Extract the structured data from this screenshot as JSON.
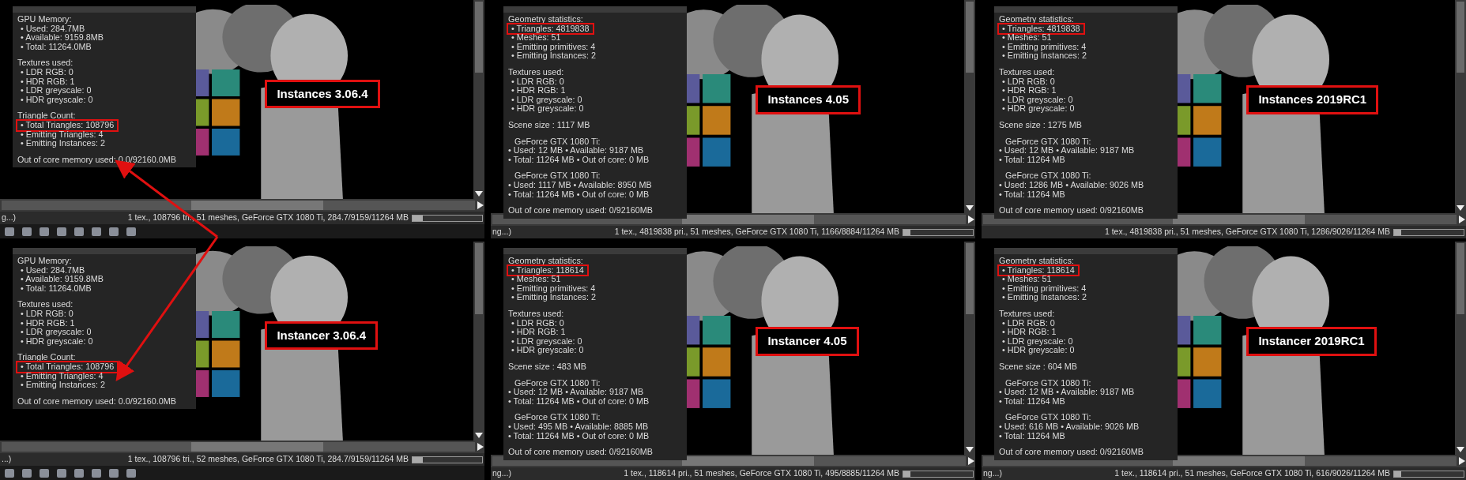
{
  "panels": [
    {
      "label": "Instances 3.06.4",
      "toolbar": true,
      "status_left": "g...)",
      "status": "1 tex., 108796 tri., 51 meshes, GeForce GTX 1080 Ti, 284.7/9159/11264 MB",
      "level": 0.15,
      "sections": [
        [
          {
            "kind": "heading",
            "text": "GPU Memory:",
            "highlighted": false
          },
          {
            "kind": "item",
            "text": "• Used: 284.7MB",
            "highlighted": false
          },
          {
            "kind": "item",
            "text": "• Available: 9159.8MB",
            "highlighted": false
          },
          {
            "kind": "item",
            "text": "• Total: 11264.0MB",
            "highlighted": false
          }
        ],
        [
          {
            "kind": "heading",
            "text": "Textures used:",
            "highlighted": false
          },
          {
            "kind": "item",
            "text": "• LDR RGB: 0",
            "highlighted": false
          },
          {
            "kind": "item",
            "text": "• HDR RGB: 1",
            "highlighted": false
          },
          {
            "kind": "item",
            "text": "• LDR greyscale: 0",
            "highlighted": false
          },
          {
            "kind": "item",
            "text": "• HDR greyscale: 0",
            "highlighted": false
          }
        ],
        [
          {
            "kind": "heading",
            "text": "Triangle Count:",
            "highlighted": false
          },
          {
            "kind": "item",
            "text": "• Total Triangles: 108796",
            "highlighted": true
          },
          {
            "kind": "item",
            "text": "• Emitting Triangles: 4",
            "highlighted": false
          },
          {
            "kind": "item",
            "text": "• Emitting Instances: 2",
            "highlighted": false
          }
        ]
      ],
      "footer": "Out of core memory used: 0.0/92160.0MB"
    },
    {
      "label": "Instances 4.05",
      "status_left": "ng...)",
      "status": "1 tex., 4819838 pri., 51 meshes, GeForce GTX 1080 Ti, 1166/8884/11264 MB",
      "level": 0.1,
      "sections": [
        [
          {
            "kind": "heading",
            "text": "Geometry statistics:",
            "highlighted": false
          },
          {
            "kind": "item",
            "text": "• Triangles: 4819838",
            "highlighted": true
          },
          {
            "kind": "item",
            "text": "• Meshes: 51",
            "highlighted": false
          },
          {
            "kind": "item",
            "text": "• Emitting primitives: 4",
            "highlighted": false
          },
          {
            "kind": "item",
            "text": "• Emitting Instances: 2",
            "highlighted": false
          }
        ],
        [
          {
            "kind": "heading",
            "text": "Textures used:",
            "highlighted": false
          },
          {
            "kind": "item",
            "text": "• LDR RGB: 0",
            "highlighted": false
          },
          {
            "kind": "item",
            "text": "• HDR RGB: 1",
            "highlighted": false
          },
          {
            "kind": "item",
            "text": "• LDR greyscale: 0",
            "highlighted": false
          },
          {
            "kind": "item",
            "text": "• HDR greyscale: 0",
            "highlighted": false
          }
        ],
        [
          {
            "kind": "heading",
            "text": "Scene size : 1117 MB",
            "highlighted": false
          }
        ],
        [
          {
            "kind": "gpu",
            "text": "GeForce GTX 1080 Ti:",
            "highlighted": false
          },
          {
            "kind": "heading",
            "text": "• Used: 12 MB • Available: 9187 MB",
            "highlighted": false
          },
          {
            "kind": "heading",
            "text": "• Total: 11264 MB • Out of core: 0 MB",
            "highlighted": false
          }
        ],
        [
          {
            "kind": "gpu",
            "text": "GeForce GTX 1080 Ti:",
            "highlighted": false
          },
          {
            "kind": "heading",
            "text": "• Used: 1117 MB • Available: 8950 MB",
            "highlighted": false
          },
          {
            "kind": "heading",
            "text": "• Total: 11264 MB • Out of core: 0 MB",
            "highlighted": false
          }
        ]
      ],
      "footer": "Out of core memory used: 0/92160MB"
    },
    {
      "label": "Instances 2019RC1",
      "status": "1 tex., 4819838 pri., 51 meshes, GeForce GTX 1080 Ti, 1286/9026/11264 MB",
      "level": 0.1,
      "sections": [
        [
          {
            "kind": "heading",
            "text": "Geometry statistics:",
            "highlighted": false
          },
          {
            "kind": "item",
            "text": "• Triangles: 4819838",
            "highlighted": true
          },
          {
            "kind": "item",
            "text": "• Meshes: 51",
            "highlighted": false
          },
          {
            "kind": "item",
            "text": "• Emitting primitives: 4",
            "highlighted": false
          },
          {
            "kind": "item",
            "text": "• Emitting Instances: 2",
            "highlighted": false
          }
        ],
        [
          {
            "kind": "heading",
            "text": "Textures used:",
            "highlighted": false
          },
          {
            "kind": "item",
            "text": "• LDR RGB: 0",
            "highlighted": false
          },
          {
            "kind": "item",
            "text": "• HDR RGB: 1",
            "highlighted": false
          },
          {
            "kind": "item",
            "text": "• LDR greyscale: 0",
            "highlighted": false
          },
          {
            "kind": "item",
            "text": "• HDR greyscale: 0",
            "highlighted": false
          }
        ],
        [
          {
            "kind": "heading",
            "text": "Scene size : 1275 MB",
            "highlighted": false
          }
        ],
        [
          {
            "kind": "gpu",
            "text": "GeForce GTX 1080 Ti:",
            "highlighted": false
          },
          {
            "kind": "heading",
            "text": "• Used: 12 MB • Available: 9187 MB",
            "highlighted": false
          },
          {
            "kind": "heading",
            "text": "• Total: 11264 MB",
            "highlighted": false
          }
        ],
        [
          {
            "kind": "gpu",
            "text": "GeForce GTX 1080 Ti:",
            "highlighted": false
          },
          {
            "kind": "heading",
            "text": "• Used: 1286 MB • Available: 9026 MB",
            "highlighted": false
          },
          {
            "kind": "heading",
            "text": "• Total: 11264 MB",
            "highlighted": false
          }
        ]
      ],
      "footer": "Out of core memory used: 0/92160MB"
    },
    {
      "label": "Instancer 3.06.4",
      "toolbar": true,
      "status_left": "...)",
      "status": "1 tex., 108796 tri., 52 meshes, GeForce GTX 1080 Ti, 284.7/9159/11264 MB",
      "level": 0.15,
      "sections": [
        [
          {
            "kind": "heading",
            "text": "GPU Memory:",
            "highlighted": false
          },
          {
            "kind": "item",
            "text": "• Used: 284.7MB",
            "highlighted": false
          },
          {
            "kind": "item",
            "text": "• Available: 9159.8MB",
            "highlighted": false
          },
          {
            "kind": "item",
            "text": "• Total: 11264.0MB",
            "highlighted": false
          }
        ],
        [
          {
            "kind": "heading",
            "text": "Textures used:",
            "highlighted": false
          },
          {
            "kind": "item",
            "text": "• LDR RGB: 0",
            "highlighted": false
          },
          {
            "kind": "item",
            "text": "• HDR RGB: 1",
            "highlighted": false
          },
          {
            "kind": "item",
            "text": "• LDR greyscale: 0",
            "highlighted": false
          },
          {
            "kind": "item",
            "text": "• HDR greyscale: 0",
            "highlighted": false
          }
        ],
        [
          {
            "kind": "heading",
            "text": "Triangle Count:",
            "highlighted": false
          },
          {
            "kind": "item",
            "text": "• Total Triangles: 108796",
            "highlighted": true
          },
          {
            "kind": "item",
            "text": "• Emitting Triangles: 4",
            "highlighted": false
          },
          {
            "kind": "item",
            "text": "• Emitting Instances: 2",
            "highlighted": false
          }
        ]
      ],
      "footer": "Out of core memory used: 0.0/92160.0MB"
    },
    {
      "label": "Instancer 4.05",
      "status_left": "ng...)",
      "status": "1 tex., 118614 pri., 51 meshes, GeForce GTX 1080 Ti, 495/8885/11264 MB",
      "level": 0.1,
      "sections": [
        [
          {
            "kind": "heading",
            "text": "Geometry statistics:",
            "highlighted": false
          },
          {
            "kind": "item",
            "text": "• Triangles: 118614",
            "highlighted": true
          },
          {
            "kind": "item",
            "text": "• Meshes: 51",
            "highlighted": false
          },
          {
            "kind": "item",
            "text": "• Emitting primitives: 4",
            "highlighted": false
          },
          {
            "kind": "item",
            "text": "• Emitting Instances: 2",
            "highlighted": false
          }
        ],
        [
          {
            "kind": "heading",
            "text": "Textures used:",
            "highlighted": false
          },
          {
            "kind": "item",
            "text": "• LDR RGB: 0",
            "highlighted": false
          },
          {
            "kind": "item",
            "text": "• HDR RGB: 1",
            "highlighted": false
          },
          {
            "kind": "item",
            "text": "• LDR greyscale: 0",
            "highlighted": false
          },
          {
            "kind": "item",
            "text": "• HDR greyscale: 0",
            "highlighted": false
          }
        ],
        [
          {
            "kind": "heading",
            "text": "Scene size : 483 MB",
            "highlighted": false
          }
        ],
        [
          {
            "kind": "gpu",
            "text": "GeForce GTX 1080 Ti:",
            "highlighted": false
          },
          {
            "kind": "heading",
            "text": "• Used: 12 MB • Available: 9187 MB",
            "highlighted": false
          },
          {
            "kind": "heading",
            "text": "• Total: 11264 MB • Out of core: 0 MB",
            "highlighted": false
          }
        ],
        [
          {
            "kind": "gpu",
            "text": "GeForce GTX 1080 Ti:",
            "highlighted": false
          },
          {
            "kind": "heading",
            "text": "• Used: 495 MB • Available: 8885 MB",
            "highlighted": false
          },
          {
            "kind": "heading",
            "text": "• Total: 11264 MB • Out of core: 0 MB",
            "highlighted": false
          }
        ]
      ],
      "footer": "Out of core memory used: 0/92160MB"
    },
    {
      "label": "Instancer 2019RC1",
      "status_left": "ng...)",
      "status": "1 tex., 118614 pri., 51 meshes, GeForce GTX 1080 Ti, 616/9026/11264 MB",
      "level": 0.1,
      "sections": [
        [
          {
            "kind": "heading",
            "text": "Geometry statistics:",
            "highlighted": false
          },
          {
            "kind": "item",
            "text": "• Triangles: 118614",
            "highlighted": true
          },
          {
            "kind": "item",
            "text": "• Meshes: 51",
            "highlighted": false
          },
          {
            "kind": "item",
            "text": "• Emitting primitives: 4",
            "highlighted": false
          },
          {
            "kind": "item",
            "text": "• Emitting Instances: 2",
            "highlighted": false
          }
        ],
        [
          {
            "kind": "heading",
            "text": "Textures used:",
            "highlighted": false
          },
          {
            "kind": "item",
            "text": "• LDR RGB: 0",
            "highlighted": false
          },
          {
            "kind": "item",
            "text": "• HDR RGB: 1",
            "highlighted": false
          },
          {
            "kind": "item",
            "text": "• LDR greyscale: 0",
            "highlighted": false
          },
          {
            "kind": "item",
            "text": "• HDR greyscale: 0",
            "highlighted": false
          }
        ],
        [
          {
            "kind": "heading",
            "text": "Scene size : 604 MB",
            "highlighted": false
          }
        ],
        [
          {
            "kind": "gpu",
            "text": "GeForce GTX 1080 Ti:",
            "highlighted": false
          },
          {
            "kind": "heading",
            "text": "• Used: 12 MB • Available: 9187 MB",
            "highlighted": false
          },
          {
            "kind": "heading",
            "text": "• Total: 11264 MB",
            "highlighted": false
          }
        ],
        [
          {
            "kind": "gpu",
            "text": "GeForce GTX 1080 Ti:",
            "highlighted": false
          },
          {
            "kind": "heading",
            "text": "• Used: 616 MB • Available: 9026 MB",
            "highlighted": false
          },
          {
            "kind": "heading",
            "text": "• Total: 11264 MB",
            "highlighted": false
          }
        ]
      ],
      "footer": "Out of core memory used: 0/92160MB"
    }
  ],
  "annotation": {
    "kind": "arrow"
  }
}
